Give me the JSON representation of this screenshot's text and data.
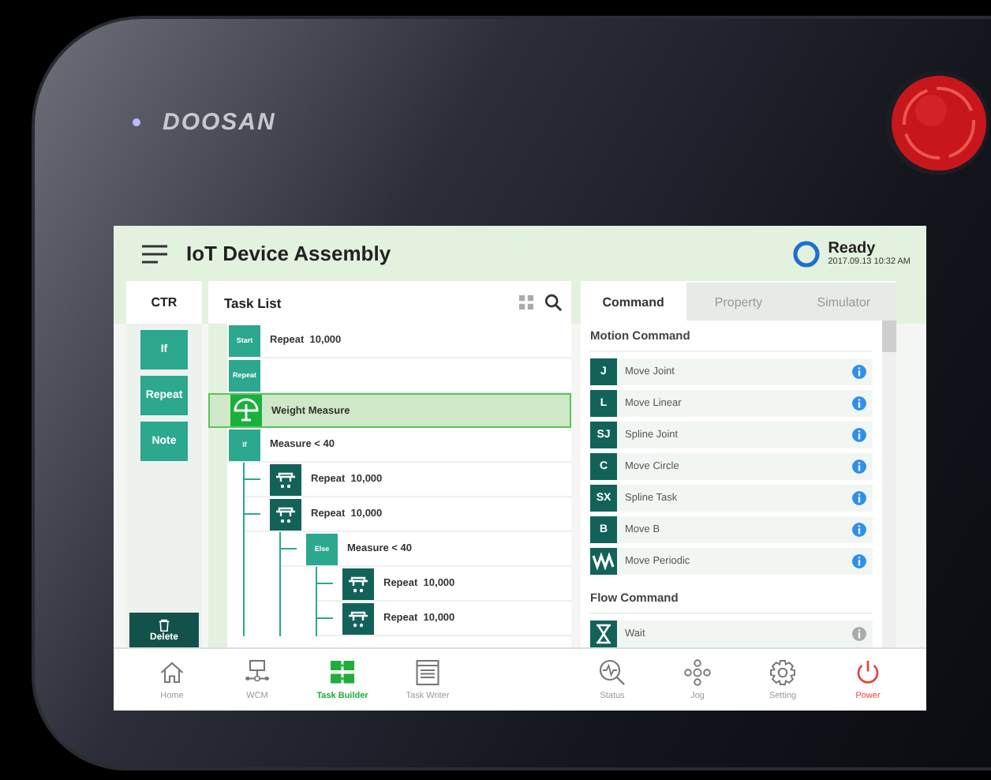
{
  "device": {
    "brand": "DOOSAN"
  },
  "header": {
    "title": "IoT Device Assembly",
    "status": "Ready",
    "datetime": "2017.09.13 10:32 AM"
  },
  "ctr": {
    "title": "CTR",
    "buttons": [
      "If",
      "Repeat",
      "Note"
    ],
    "delete": "Delete"
  },
  "task_list": {
    "title": "Task List",
    "rows": [
      {
        "kind": "text",
        "badge": "Start",
        "label": "Repeat  10,000",
        "selected": false
      },
      {
        "kind": "text",
        "badge": "Repeat",
        "selected": false
      },
      {
        "kind": "scale",
        "label": "Weight Measure",
        "selected": true
      },
      {
        "kind": "text",
        "badge": "If",
        "label": "Measure < 40",
        "selected": false,
        "children": [
          {
            "kind": "repeat",
            "label": "Repeat  10,000",
            "selected": false
          },
          {
            "kind": "repeat",
            "label": "Repeat  10,000",
            "selected": false,
            "children": [
              {
                "kind": "text",
                "badge": "Else",
                "label": "Measure < 40",
                "selected": false,
                "children": [
                  {
                    "kind": "repeat",
                    "label": "Repeat  10,000",
                    "selected": false
                  },
                  {
                    "kind": "repeat",
                    "label": "Repeat  10,000",
                    "selected": false
                  }
                ]
              }
            ]
          }
        ]
      }
    ]
  },
  "command_panel": {
    "tabs": [
      {
        "label": "Command",
        "selected": true
      },
      {
        "label": "Property",
        "selected": false
      },
      {
        "label": "Simulator",
        "selected": false
      }
    ],
    "sections": [
      {
        "title": "Motion Command",
        "items": [
          {
            "kind": "letter",
            "icon": "J",
            "label": "Move Joint",
            "disabled": false
          },
          {
            "kind": "letter",
            "icon": "L",
            "label": "Move Linear",
            "disabled": false
          },
          {
            "kind": "letter",
            "icon": "SJ",
            "label": "Spline Joint",
            "disabled": false
          },
          {
            "kind": "letter",
            "icon": "C",
            "label": "Move Circle",
            "disabled": false
          },
          {
            "kind": "letter",
            "icon": "SX",
            "label": "Spline Task",
            "disabled": false
          },
          {
            "kind": "letter",
            "icon": "B",
            "label": "Move B",
            "disabled": false
          },
          {
            "kind": "wave",
            "label": "Move Periodic",
            "disabled": false
          }
        ]
      },
      {
        "title": "Flow Command",
        "items": [
          {
            "kind": "hourglass",
            "label": "Wait",
            "disabled": true
          }
        ]
      }
    ]
  },
  "nav": {
    "items": [
      {
        "kind": "home",
        "label": "Home",
        "selected": false
      },
      {
        "kind": "wcm",
        "label": "WCM",
        "selected": false
      },
      {
        "kind": "builder",
        "label": "Task Builder",
        "selected": true
      },
      {
        "kind": "writer",
        "label": "Task Writer",
        "selected": false
      },
      {
        "kind": "spacer"
      },
      {
        "kind": "status",
        "label": "Status",
        "selected": false
      },
      {
        "kind": "jog",
        "label": "Jog",
        "selected": false
      },
      {
        "kind": "setting",
        "label": "Setting",
        "selected": false
      },
      {
        "kind": "power",
        "label": "Power",
        "selected": false
      }
    ]
  }
}
